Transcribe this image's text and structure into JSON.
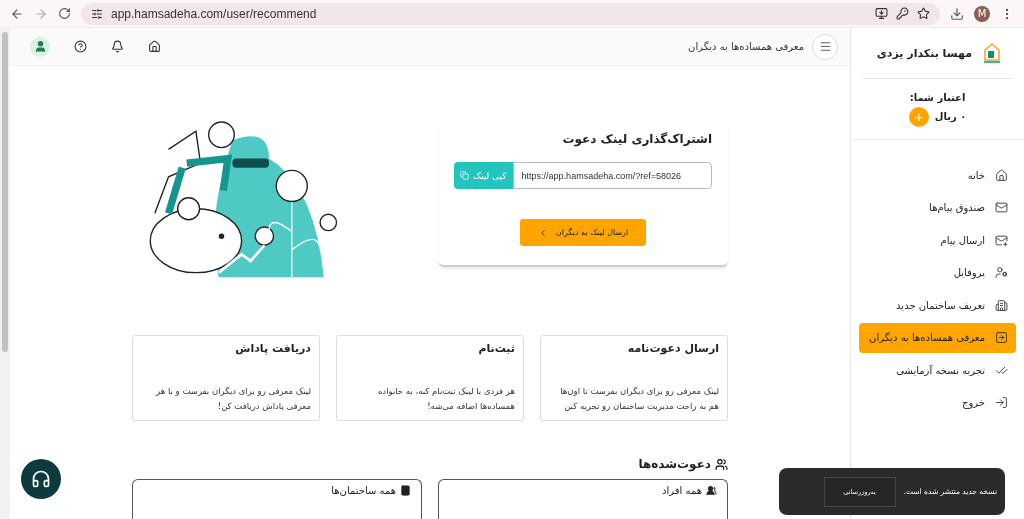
{
  "browser": {
    "url": "app.hamsadeha.com/user/recommend",
    "profile_letter": "M"
  },
  "header": {
    "title": "معرفی همساده‌ها به دیگران"
  },
  "sidebar": {
    "user_name": "مهسا بنکدار یزدی",
    "credit_label": "اعتبار شما:",
    "credit_value": "۰ ریال",
    "add_credit": "+",
    "items": [
      {
        "label": "خانه",
        "selected": false
      },
      {
        "label": "صندوق پیام‌ها",
        "selected": false
      },
      {
        "label": "ارسال پیام",
        "selected": false
      },
      {
        "label": "پروفایل",
        "selected": false
      },
      {
        "label": "تعریف ساختمان جدید",
        "selected": false
      },
      {
        "label": "معرفی همساده‌ها به دیگران",
        "selected": true
      },
      {
        "label": "تجربه نسخه آزمایشی",
        "selected": false
      },
      {
        "label": "خروج",
        "selected": false
      }
    ]
  },
  "invite": {
    "title": "اشتراک‌گذاری لینک دعوت",
    "copy_label": "کپی لینک",
    "link": "https://app.hamsadeha.com/?ref=58026",
    "send_label": "ارسال لینک به دیگران"
  },
  "steps": [
    {
      "title": "ارسال دعوت‌نامه",
      "text": "لینک معرفی رو برای دیگران بفرست تا اون‌ها هم به راحت مدیریت ساختمان رو تجربه کنن"
    },
    {
      "title": "ثبت‌نام",
      "text": "هر فردی با لینک ثبت‌نام کنه، به خانواده همساده‌ها اضافه می‌شه!"
    },
    {
      "title": "دریافت پاداش",
      "text": "لینک معرفی رو برای دیگران بفرست و با هر معرفی پاداش دریافت کن!"
    }
  ],
  "invited": {
    "title": "دعوت‌شده‌ها",
    "tabs": [
      {
        "label": "همه افراد"
      },
      {
        "label": "همه ساختمان‌ها"
      }
    ]
  },
  "toast": {
    "message": "نسخه جدید منتشر شده است.",
    "button": "به‌روزرسانی"
  }
}
